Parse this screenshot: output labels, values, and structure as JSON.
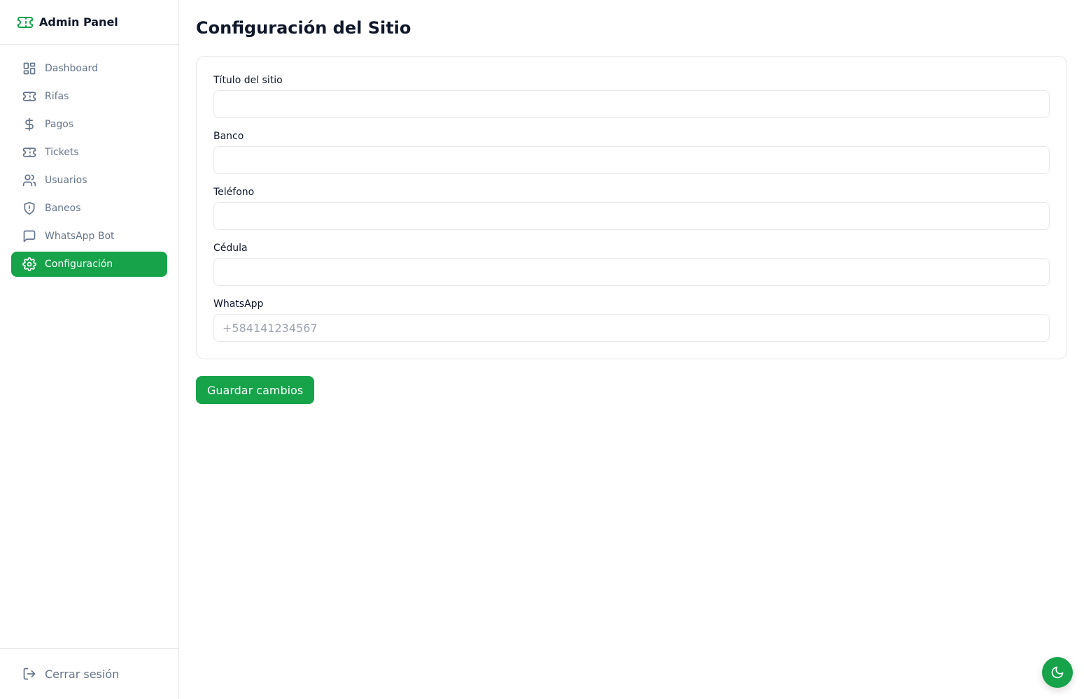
{
  "app": {
    "title": "Admin Panel"
  },
  "colors": {
    "accent": "#16a34a",
    "muted_text": "#64748b",
    "border": "#e5e7eb"
  },
  "sidebar": {
    "items": [
      {
        "label": "Dashboard",
        "icon": "dashboard-icon",
        "active": false
      },
      {
        "label": "Rifas",
        "icon": "ticket-icon",
        "active": false
      },
      {
        "label": "Pagos",
        "icon": "dollar-icon",
        "active": false
      },
      {
        "label": "Tickets",
        "icon": "ticket-icon",
        "active": false
      },
      {
        "label": "Usuarios",
        "icon": "users-icon",
        "active": false
      },
      {
        "label": "Baneos",
        "icon": "shield-icon",
        "active": false
      },
      {
        "label": "WhatsApp Bot",
        "icon": "message-icon",
        "active": false
      },
      {
        "label": "Configuración",
        "icon": "gear-icon",
        "active": true
      }
    ],
    "logout_label": "Cerrar sesión"
  },
  "main": {
    "title": "Configuración del Sitio",
    "fields": [
      {
        "label": "Título del sitio",
        "value": "",
        "placeholder": ""
      },
      {
        "label": "Banco",
        "value": "",
        "placeholder": ""
      },
      {
        "label": "Teléfono",
        "value": "",
        "placeholder": ""
      },
      {
        "label": "Cédula",
        "value": "",
        "placeholder": ""
      },
      {
        "label": "WhatsApp",
        "value": "",
        "placeholder": "+584141234567"
      }
    ],
    "save_label": "Guardar cambios"
  },
  "theme_toggle": {
    "icon": "moon-icon"
  }
}
